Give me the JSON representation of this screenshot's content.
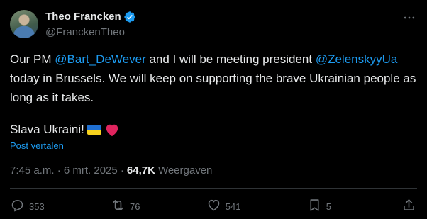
{
  "author": {
    "display_name": "Theo Francken",
    "handle": "@FranckenTheo"
  },
  "tweet": {
    "line1_pre": "Our PM ",
    "mention1": "@Bart_DeWever",
    "line1_mid": " and I will be meeting president ",
    "mention2": "@ZelenskyyUa",
    "line2": " today in Brussels. We will keep on supporting the brave Ukrainian people as long as it takes.",
    "slava": "Slava Ukraini!",
    "translate_label": "Post vertalen"
  },
  "meta": {
    "timestamp": "7:45 a.m. · 6 mrt. 2025 ·",
    "views_count": "64,7K",
    "views_label": "Weergaven"
  },
  "actions": {
    "replies": "353",
    "reposts": "76",
    "likes": "541",
    "bookmarks": "5"
  },
  "colors": {
    "accent": "#1d9bf0",
    "muted": "#71767b",
    "text": "#e7e9ea",
    "background": "#000000"
  },
  "icons": [
    "verified-badge-icon",
    "more-icon",
    "flag-ukraine-icon",
    "red-heart-icon",
    "reply-icon",
    "repost-icon",
    "like-icon",
    "bookmark-icon",
    "share-icon"
  ]
}
